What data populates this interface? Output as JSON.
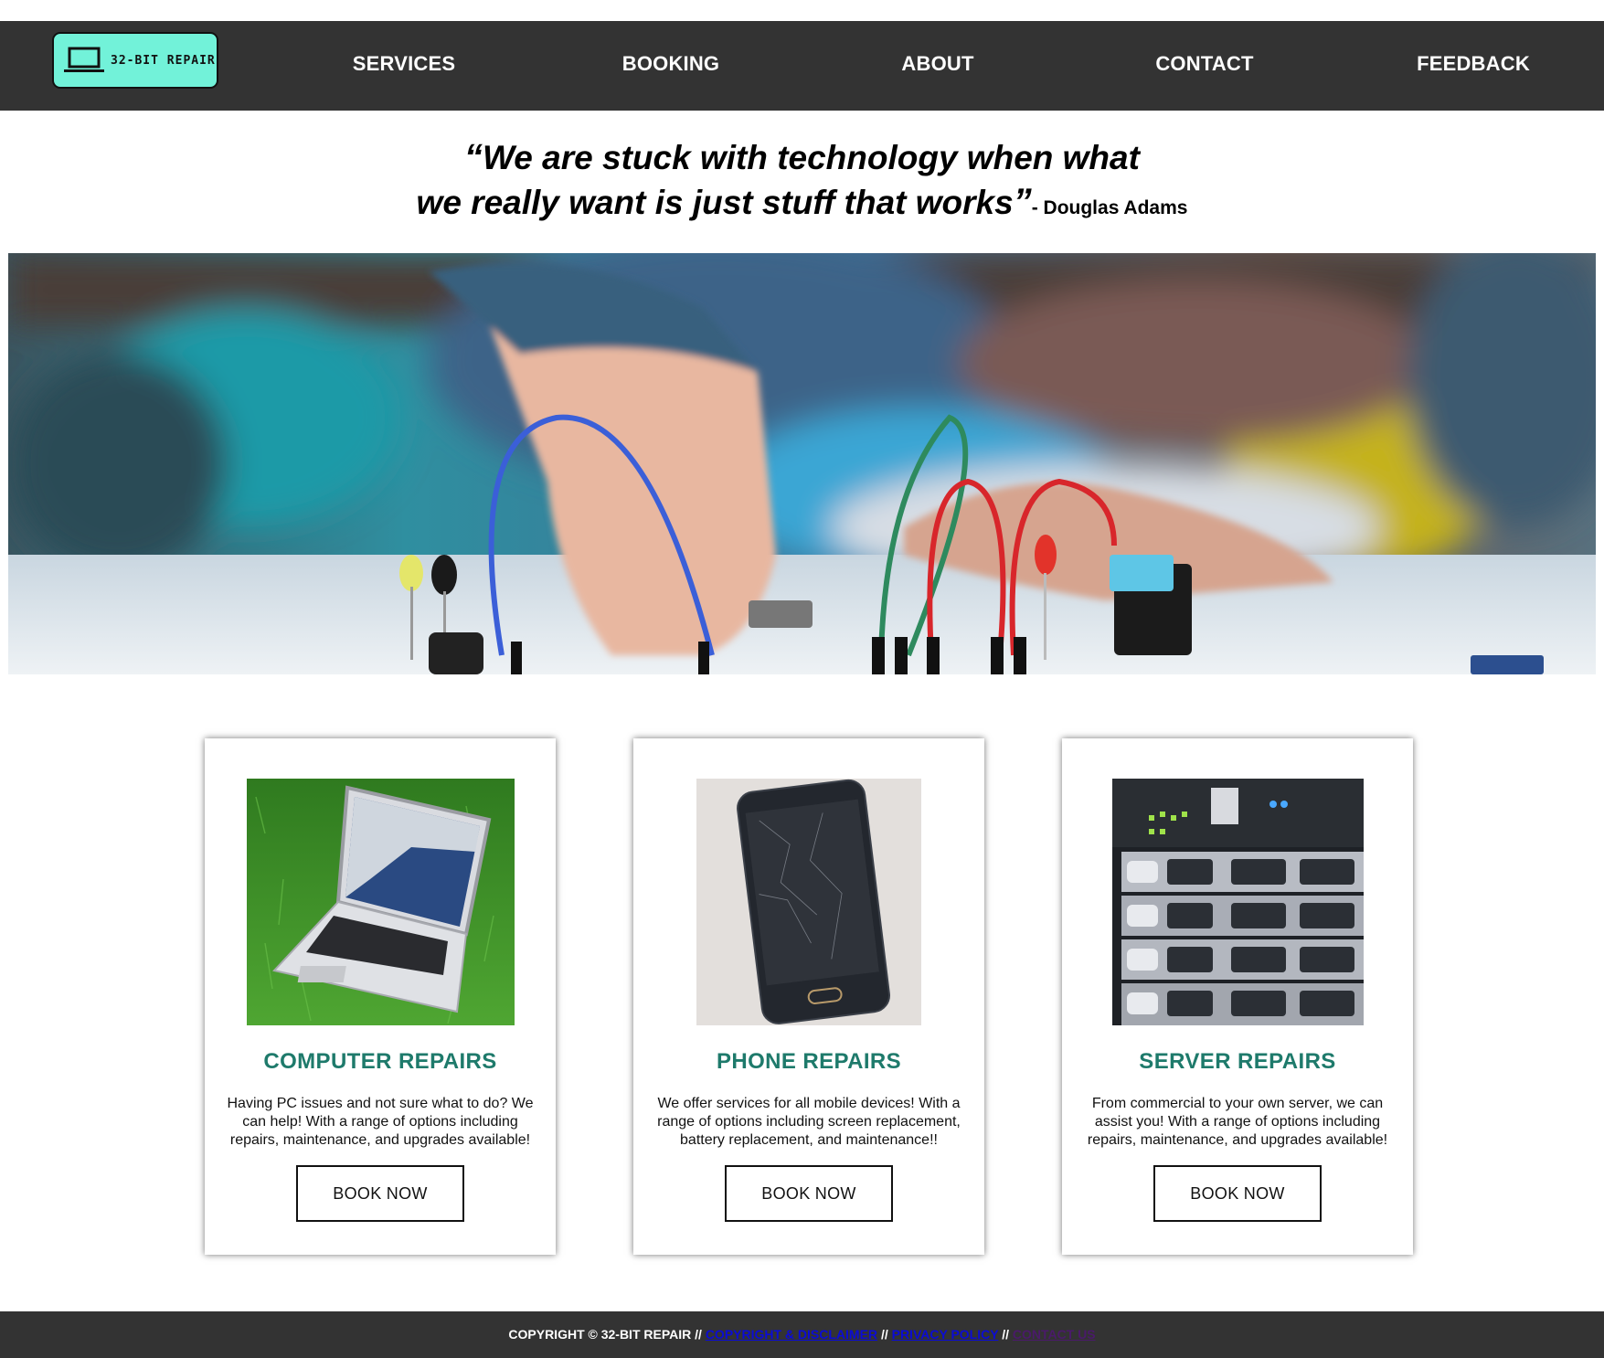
{
  "nav": {
    "logo_text": "32-BIT REPAIR",
    "links": [
      "SERVICES",
      "BOOKING",
      "ABOUT",
      "CONTACT",
      "FEEDBACK"
    ]
  },
  "quote": {
    "open_mark": "“",
    "line1": "We are stuck with technology when what",
    "line2": "we really want is just stuff that works",
    "close_mark": "”",
    "author": "- Douglas Adams"
  },
  "cards": [
    {
      "title": "COMPUTER REPAIRS",
      "text": "Having PC issues and not sure what to do? We can help! With a range of options including repairs, maintenance, and upgrades available!",
      "button": "BOOK NOW"
    },
    {
      "title": "PHONE REPAIRS",
      "text": "We offer services for all mobile devices! With a range of options including screen replacement, battery replacement, and maintenance!!",
      "button": "BOOK NOW"
    },
    {
      "title": "SERVER REPAIRS",
      "text": "From commercial to your own server, we can assist you! With a range of options including repairs, maintenance, and upgrades available!",
      "button": "BOOK NOW"
    }
  ],
  "footer": {
    "copyright": "COPYRIGHT © 32-BIT REPAIR",
    "sep": "//",
    "link1": "COPYRIGHT & DISCLAIMER",
    "link2": "PRIVACY POLICY",
    "link3": "CONTACT US"
  },
  "colors": {
    "nav_bg": "#333333",
    "logo_bg": "#72f2d9",
    "card_title": "#1e7a6b",
    "footer_link": "#0b0bd6",
    "footer_link_visited": "#4a1a6a"
  },
  "icons": {
    "logo": "laptop-icon"
  }
}
